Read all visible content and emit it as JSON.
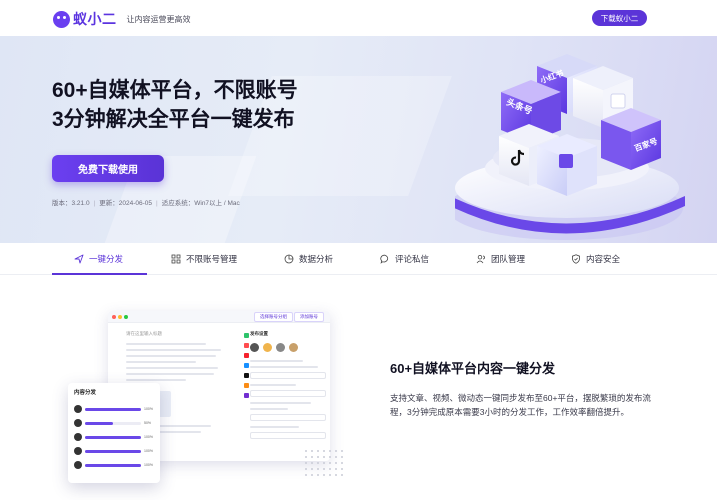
{
  "header": {
    "brand_name": "蚁小二",
    "slogan": "让内容运营更高效",
    "download_button": "下载蚁小二"
  },
  "hero": {
    "title_line1": "60+自媒体平台，不限账号",
    "title_line2": "3分钟解决全平台一键发布",
    "download_button": "免费下载使用",
    "version": "版本：3.21.0",
    "updated": "更新：2024-06-05",
    "system": "适应系统：Win7以上 / Mac",
    "art_labels": {
      "toutiao": "头条号",
      "baijia": "百家号",
      "top_cube": "小红书"
    }
  },
  "tabs": [
    {
      "label": "一键分发",
      "icon": "send-icon"
    },
    {
      "label": "不限账号管理",
      "icon": "grid-icon"
    },
    {
      "label": "数据分析",
      "icon": "pie-chart-icon"
    },
    {
      "label": "评论私信",
      "icon": "chat-icon"
    },
    {
      "label": "团队管理",
      "icon": "team-icon"
    },
    {
      "label": "内容安全",
      "icon": "shield-icon"
    }
  ],
  "feature": {
    "title": "60+自媒体平台内容一键分发",
    "description": "支持文章、视频、微动态一键同步发布至60+平台，摆脱繁琐的发布流程，3分钟完成原本需要3小时的分发工作，工作效率翻倍提升。"
  },
  "mockup": {
    "tab1": "选择账号分组",
    "tab2": "添加账号",
    "editor_placeholder": "请在这里输入标题",
    "side_title": "发布设置",
    "popup_title": "内容分发",
    "progress": [
      100,
      50,
      100,
      100,
      100
    ],
    "progress_labels": [
      "100%",
      "50%",
      "100%",
      "100%",
      "100%"
    ]
  },
  "colors": {
    "accent": "#5b34d8",
    "hero_bg": "#e3e9f6"
  }
}
